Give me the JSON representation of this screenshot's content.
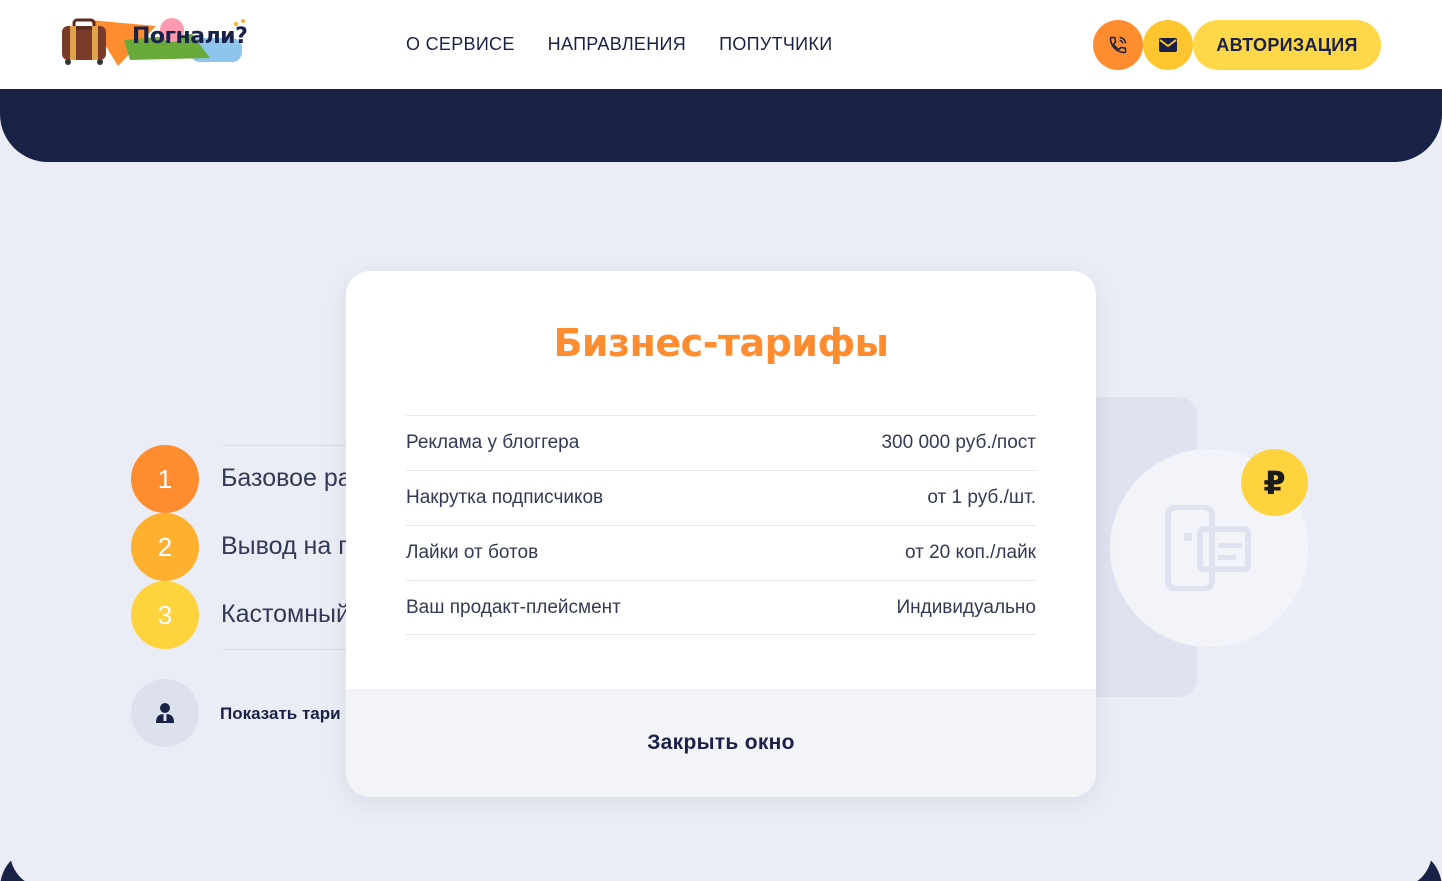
{
  "header": {
    "logo_text": "Погнали?",
    "nav": [
      "О СЕРВИСЕ",
      "НАПРАВЛЕНИЯ",
      "ПОПУТЧИКИ"
    ],
    "auth_label": "АВТОРИЗАЦИЯ"
  },
  "steps": [
    {
      "num": "1",
      "label": "Базовое ра",
      "color": "#ff8c2f"
    },
    {
      "num": "2",
      "label": "Вывод на г",
      "color": "#ffb02f"
    },
    {
      "num": "3",
      "label": "Кастомный",
      "color": "#ffd33d"
    }
  ],
  "show_tariffs_label": "Показать тари",
  "ruble_symbol": "₽",
  "modal": {
    "title": "Бизнес-тарифы",
    "rows": [
      {
        "name": "Реклама у блоггера",
        "price": "300 000 руб./пост"
      },
      {
        "name": "Накрутка подписчиков",
        "price": "от 1 руб./шт."
      },
      {
        "name": "Лайки от ботов",
        "price": "от 20 коп./лайк"
      },
      {
        "name": "Ваш продакт-плейсмент",
        "price": "Индивидуально"
      }
    ],
    "close_label": "Закрыть окно"
  },
  "colors": {
    "navy": "#1a2147",
    "orange": "#ff8c2f",
    "yellow": "#ffd84a",
    "background": "#eaedf5"
  }
}
